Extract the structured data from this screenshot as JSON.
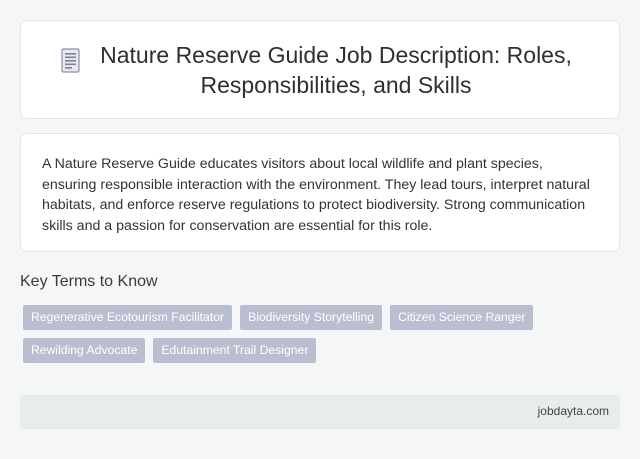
{
  "header": {
    "icon": "document-icon",
    "title": "Nature Reserve Guide Job Description: Roles, Responsibilities, and Skills"
  },
  "description": {
    "text": "A Nature Reserve Guide educates visitors about local wildlife and plant species, ensuring responsible interaction with the environment. They lead tours, interpret natural habitats, and enforce reserve regulations to protect biodiversity. Strong communication skills and a passion for conservation are essential for this role."
  },
  "key_terms": {
    "heading": "Key Terms to Know",
    "tags": [
      "Regenerative Ecotourism Facilitator",
      "Biodiversity Storytelling",
      "Citizen Science Ranger",
      "Rewilding Advocate",
      "Edutainment Trail Designer"
    ]
  },
  "footer": {
    "site": "jobdayta.com"
  },
  "colors": {
    "tag_bg": "#b9bfd0",
    "footer_bg": "#e7eced",
    "page_bg": "#f4f6f8"
  }
}
